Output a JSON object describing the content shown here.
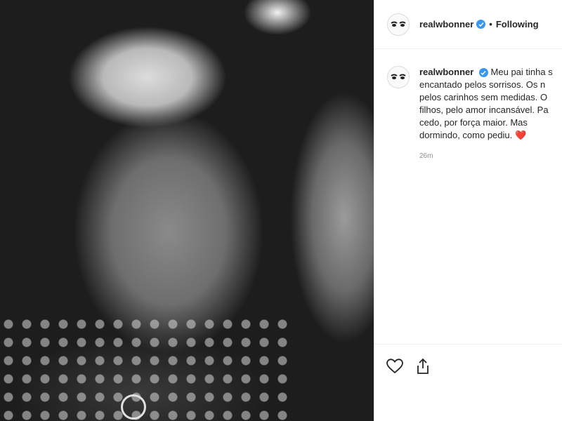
{
  "post": {
    "username": "realwbonner",
    "follow_status": "Following",
    "separator": "•",
    "caption_lines": [
      "Meu pai tinha s",
      "encantado pelos sorrisos. Os n",
      "pelos carinhos sem medidas. O",
      "filhos, pelo amor incansável. Pa",
      "cedo, por força maior. Mas",
      "dormindo, como pediu."
    ],
    "caption_emoji": "❤️",
    "timestamp": "26m"
  },
  "icons": {
    "verified": "verified-badge-icon",
    "like": "heart-outline-icon",
    "share": "share-icon",
    "avatar": "eyes-avatar-icon"
  },
  "colors": {
    "verified": "#3897f0",
    "heart": "#ed4956",
    "border": "#efefef",
    "muted_text": "#8e8e8e"
  }
}
